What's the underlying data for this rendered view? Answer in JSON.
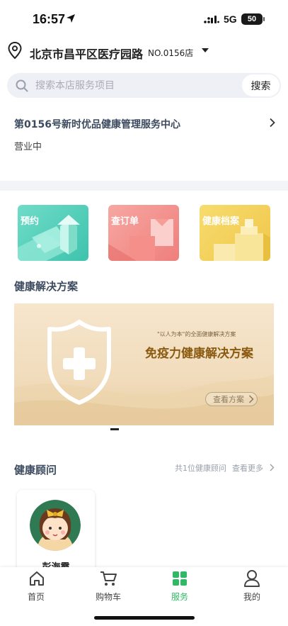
{
  "status_bar": {
    "time": "16:57",
    "network": "5G",
    "battery": "50"
  },
  "location": {
    "address": "北京市昌平区医疗园路",
    "store_no": "NO.0156店"
  },
  "search": {
    "placeholder": "搜索本店服务项目",
    "value": "",
    "button_label": "搜索"
  },
  "store": {
    "name": "第0156号新时优品健康管理服务中心",
    "status": "营业中"
  },
  "quick_actions": [
    {
      "label": "预约",
      "icon": "appointment-illustration",
      "color": "#4fcfb8"
    },
    {
      "label": "查订单",
      "icon": "order-illustration",
      "color": "#f28f8b"
    },
    {
      "label": "健康档案",
      "icon": "records-illustration",
      "color": "#f3cf55"
    }
  ],
  "solutions": {
    "section_title": "健康解决方案",
    "banner": {
      "subtitle": "\"以人为本\"的全面健康解决方案",
      "title": "免疫力健康解决方案",
      "button_label": "查看方案",
      "icon": "shield-cross-icon"
    }
  },
  "advisors": {
    "section_title": "健康顾问",
    "count_text": "共1位健康顾问",
    "more_label": "查看更多",
    "items": [
      {
        "name": "彭海霞"
      }
    ]
  },
  "tabbar": {
    "active_color": "#2fb865",
    "items": [
      {
        "label": "首页",
        "icon": "home-icon"
      },
      {
        "label": "购物车",
        "icon": "cart-icon"
      },
      {
        "label": "服务",
        "icon": "service-grid-icon",
        "active": true
      },
      {
        "label": "我的",
        "icon": "user-icon"
      }
    ]
  }
}
